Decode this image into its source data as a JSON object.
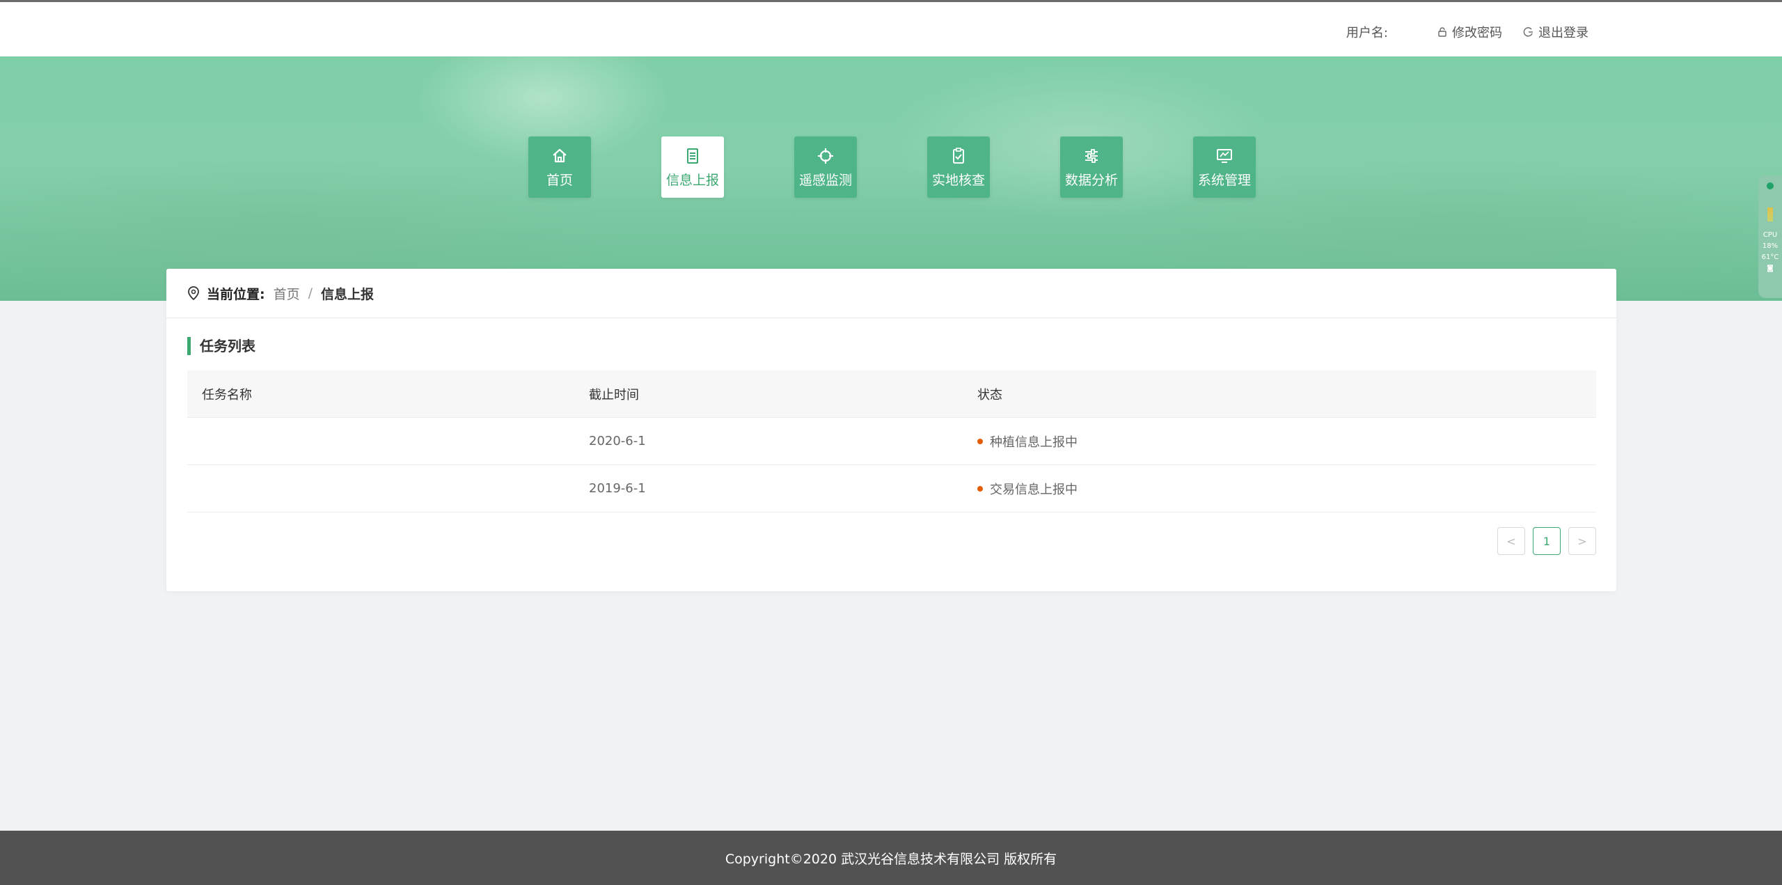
{
  "header": {
    "username_label": "用户名:",
    "change_password": "修改密码",
    "logout": "退出登录"
  },
  "nav": {
    "items": [
      {
        "label": "首页",
        "icon": "home-icon",
        "active": false
      },
      {
        "label": "信息上报",
        "icon": "document-icon",
        "active": true
      },
      {
        "label": "遥感监测",
        "icon": "crosshair-icon",
        "active": false
      },
      {
        "label": "实地核查",
        "icon": "clipboard-check-icon",
        "active": false
      },
      {
        "label": "数据分析",
        "icon": "sliders-icon",
        "active": false
      },
      {
        "label": "系统管理",
        "icon": "monitor-icon",
        "active": false
      }
    ]
  },
  "side_widget": {
    "cpu_label": "CPU",
    "cpu_usage": "18%",
    "temperature": "61°C"
  },
  "breadcrumb": {
    "label": "当前位置:",
    "items": [
      "首页",
      "信息上报"
    ],
    "separator": "/"
  },
  "section": {
    "title": "任务列表"
  },
  "table": {
    "columns": [
      "任务名称",
      "截止时间",
      "状态"
    ],
    "rows": [
      {
        "name": "",
        "deadline": "2020-6-1",
        "status": "种植信息上报中"
      },
      {
        "name": "",
        "deadline": "2019-6-1",
        "status": "交易信息上报中"
      }
    ],
    "status_color": "#e35d08"
  },
  "pagination": {
    "prev": "<",
    "current": "1",
    "next": ">"
  },
  "footer": {
    "copyright": "Copyright©2020 武汉光谷信息技术有限公司 版权所有"
  },
  "colors": {
    "accent": "#3ba870",
    "nav_bg": "#4fb487",
    "footer_bg": "#525252"
  }
}
